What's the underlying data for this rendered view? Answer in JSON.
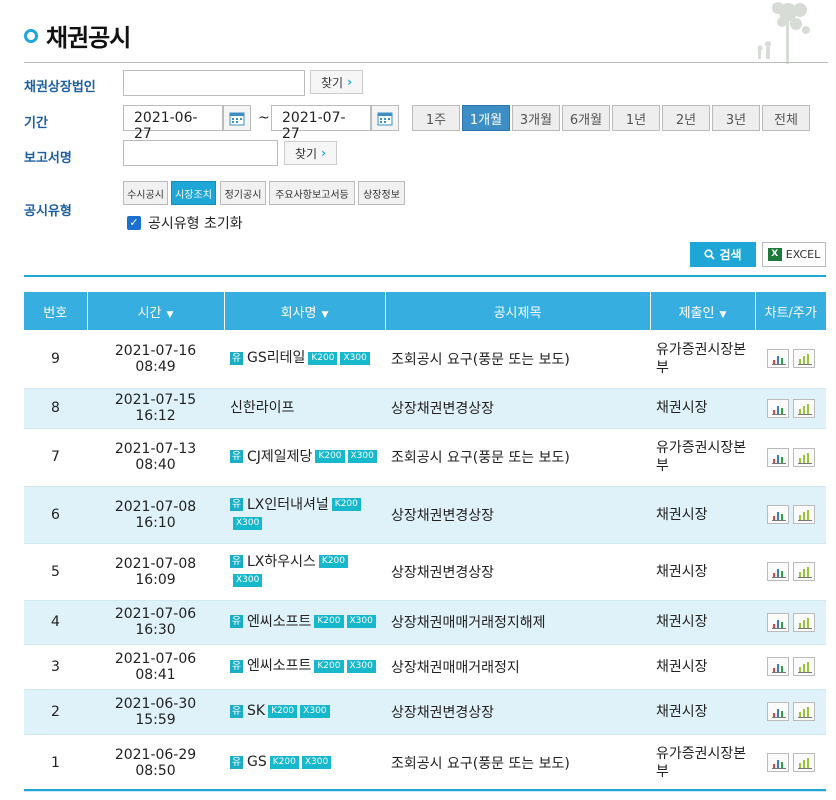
{
  "page": {
    "title": "채권공시"
  },
  "form": {
    "company_label": "채권상장법인",
    "find_label": "찾기",
    "period_label": "기간",
    "date_from": "2021-06-27",
    "tilde": "~",
    "date_to": "2021-07-27",
    "periods": [
      "1주",
      "1개월",
      "3개월",
      "6개월",
      "1년",
      "2년",
      "3년",
      "전체"
    ],
    "report_label": "보고서명",
    "type_label": "공시유형",
    "types": [
      "수시공시",
      "시장조치",
      "정기공시",
      "주요사항보고서등",
      "상장정보"
    ],
    "reset_label": "공시유형 초기화",
    "search_label": "검색",
    "excel_label": "EXCEL"
  },
  "table": {
    "headers": {
      "no": "번호",
      "time": "시간",
      "company": "회사명",
      "title": "공시제목",
      "submitter": "제출인",
      "chart": "차트/주가"
    },
    "rows": [
      {
        "no": "9",
        "time": "2021-07-16 08:49",
        "yu": "유",
        "company": "GS리테일",
        "badges": [
          "K200",
          "X300"
        ],
        "title": "조회공시 요구(풍문 또는 보도)",
        "submitter": "유가증권시장본부"
      },
      {
        "no": "8",
        "time": "2021-07-15 16:12",
        "yu": "",
        "company": "신한라이프",
        "badges": [],
        "title": "상장채권변경상장",
        "submitter": "채권시장"
      },
      {
        "no": "7",
        "time": "2021-07-13 08:40",
        "yu": "유",
        "company": "CJ제일제당",
        "badges": [
          "K200",
          "X300"
        ],
        "title": "조회공시 요구(풍문 또는 보도)",
        "submitter": "유가증권시장본부"
      },
      {
        "no": "6",
        "time": "2021-07-08 16:10",
        "yu": "유",
        "company": "LX인터내셔널",
        "badges": [
          "K200",
          "X300"
        ],
        "title": "상장채권변경상장",
        "submitter": "채권시장"
      },
      {
        "no": "5",
        "time": "2021-07-08 16:09",
        "yu": "유",
        "company": "LX하우시스",
        "badges": [
          "K200",
          "X300"
        ],
        "title": "상장채권변경상장",
        "submitter": "채권시장"
      },
      {
        "no": "4",
        "time": "2021-07-06 16:30",
        "yu": "유",
        "company": "엔씨소프트",
        "badges": [
          "K200",
          "X300"
        ],
        "title": "상장채권매매거래정지해제",
        "submitter": "채권시장"
      },
      {
        "no": "3",
        "time": "2021-07-06 08:41",
        "yu": "유",
        "company": "엔씨소프트",
        "badges": [
          "K200",
          "X300"
        ],
        "title": "상장채권매매거래정지",
        "submitter": "채권시장"
      },
      {
        "no": "2",
        "time": "2021-06-30 15:59",
        "yu": "유",
        "company": "SK",
        "badges": [
          "K200",
          "X300"
        ],
        "title": "상장채권변경상장",
        "submitter": "채권시장"
      },
      {
        "no": "1",
        "time": "2021-06-29 08:50",
        "yu": "유",
        "company": "GS",
        "badges": [
          "K200",
          "X300"
        ],
        "title": "조회공시 요구(풍문 또는 보도)",
        "submitter": "유가증권시장본부"
      }
    ]
  },
  "colors": {
    "accent": "#1ea7d6",
    "header_bg": "#36aee0",
    "row_alt": "#dff2f9",
    "period_active": "#3d8ec4"
  }
}
